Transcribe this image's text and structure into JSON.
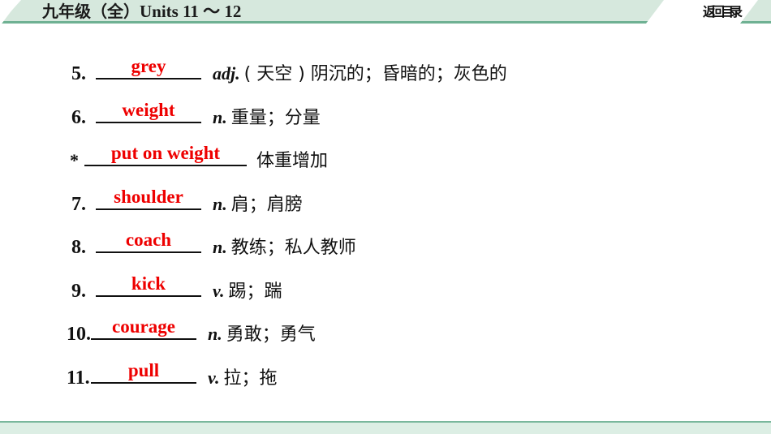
{
  "header": {
    "title_cjk": "九年级（全）",
    "title_latin": "Units 11 ～ 12",
    "back_label": "返回目录",
    "band_color": "#d6e8dd",
    "band_border_color": "#6fb193"
  },
  "footer": {
    "bar_color": "#dceee4",
    "bar_border_color": "#79b79c"
  },
  "answer_color": "#ee0000",
  "entries": [
    {
      "marker": "5.",
      "marker_type": "number",
      "answer": "grey",
      "pos": "adj.",
      "meaning": "( 天空 ) 阴沉的；昏暗的；灰色的"
    },
    {
      "marker": "6.",
      "marker_type": "number",
      "answer": "weight",
      "pos": "n.",
      "meaning": "重量；分量"
    },
    {
      "marker": "*",
      "marker_type": "star",
      "answer": "put on weight",
      "pos": "",
      "meaning": "体重增加"
    },
    {
      "marker": "7.",
      "marker_type": "number",
      "answer": "shoulder",
      "pos": "n.",
      "meaning": "肩；肩膀"
    },
    {
      "marker": "8.",
      "marker_type": "number",
      "answer": "coach",
      "pos": "n.",
      "meaning": "教练；私人教师"
    },
    {
      "marker": "9.",
      "marker_type": "number",
      "answer": "kick",
      "pos": "v.",
      "meaning": "踢；踹"
    },
    {
      "marker": "10.",
      "marker_type": "number",
      "answer": "courage",
      "pos": "n.",
      "meaning": "勇敢；勇气"
    },
    {
      "marker": "11.",
      "marker_type": "number",
      "answer": "pull",
      "pos": "v.",
      "meaning": "拉；拖"
    }
  ]
}
